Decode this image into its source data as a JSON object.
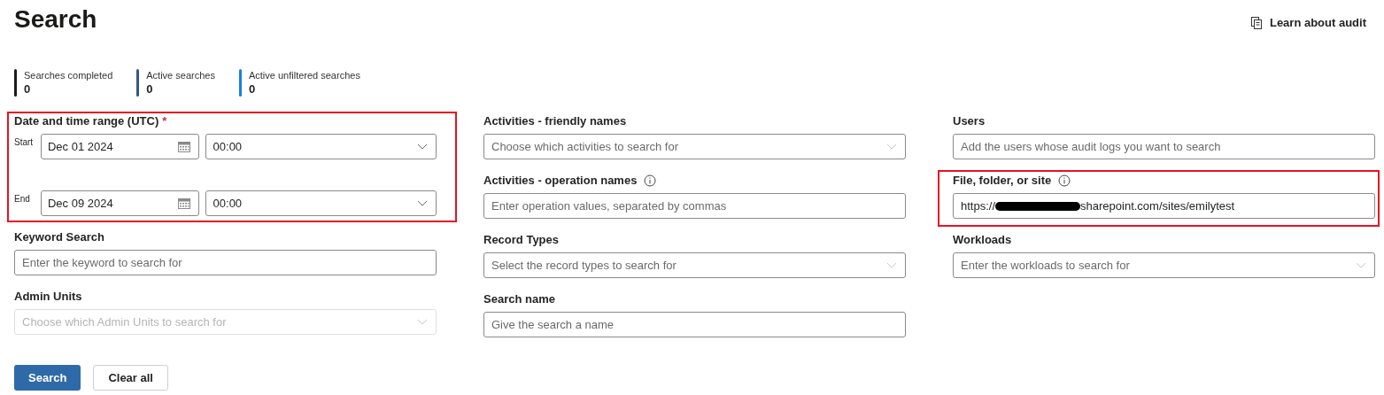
{
  "page_title": "Search",
  "learn_link": "Learn about audit",
  "stats": [
    {
      "label": "Searches completed",
      "value": "0",
      "color": "#1b1a19"
    },
    {
      "label": "Active searches",
      "value": "0",
      "color": "#34558b"
    },
    {
      "label": "Active unfiltered searches",
      "value": "0",
      "color": "#1a7fe3"
    }
  ],
  "columns": [
    {
      "items": [
        {
          "kind": "date_range",
          "label": "Date and time range (UTC)",
          "required": "*",
          "highlighted": true,
          "rows": [
            {
              "label": "Start",
              "date": "Dec 01 2024",
              "time": "00:00"
            },
            {
              "label": "End",
              "date": "Dec 09 2024",
              "time": "00:00"
            }
          ]
        },
        {
          "kind": "text",
          "label": "Keyword Search",
          "placeholder": "Enter the keyword to search for",
          "highlighted": false,
          "info": false
        },
        {
          "kind": "dropdown",
          "label": "Admin Units",
          "placeholder": "Choose which Admin Units to search for",
          "highlighted": false,
          "info": false,
          "disabled": true
        }
      ]
    },
    {
      "items": [
        {
          "kind": "dropdown",
          "label": "Activities - friendly names",
          "placeholder": "Choose which activities to search for",
          "highlighted": false,
          "info": false,
          "disabled": false
        },
        {
          "kind": "text",
          "label": "Activities - operation names",
          "placeholder": "Enter operation values, separated by commas",
          "highlighted": false,
          "info": true
        },
        {
          "kind": "dropdown",
          "label": "Record Types",
          "placeholder": "Select the record types to search for",
          "highlighted": false,
          "info": false,
          "disabled": false
        },
        {
          "kind": "text",
          "label": "Search name",
          "placeholder": "Give the search a name",
          "highlighted": false,
          "info": false
        }
      ]
    },
    {
      "items": [
        {
          "kind": "text",
          "label": "Users",
          "placeholder": "Add the users whose audit logs you want to search",
          "highlighted": false,
          "info": false
        },
        {
          "kind": "redacted_value",
          "label": "File, folder, or site",
          "value_parts": [
            "https://",
            "sharepoint.com/sites/emilytest"
          ],
          "highlighted": true,
          "info": true
        },
        {
          "kind": "dropdown",
          "label": "Workloads",
          "placeholder": "Enter the workloads to search for",
          "highlighted": false,
          "info": false,
          "disabled": false
        }
      ]
    }
  ],
  "buttons": [
    {
      "label": "Search",
      "primary": true
    },
    {
      "label": "Clear all",
      "primary": false
    }
  ]
}
